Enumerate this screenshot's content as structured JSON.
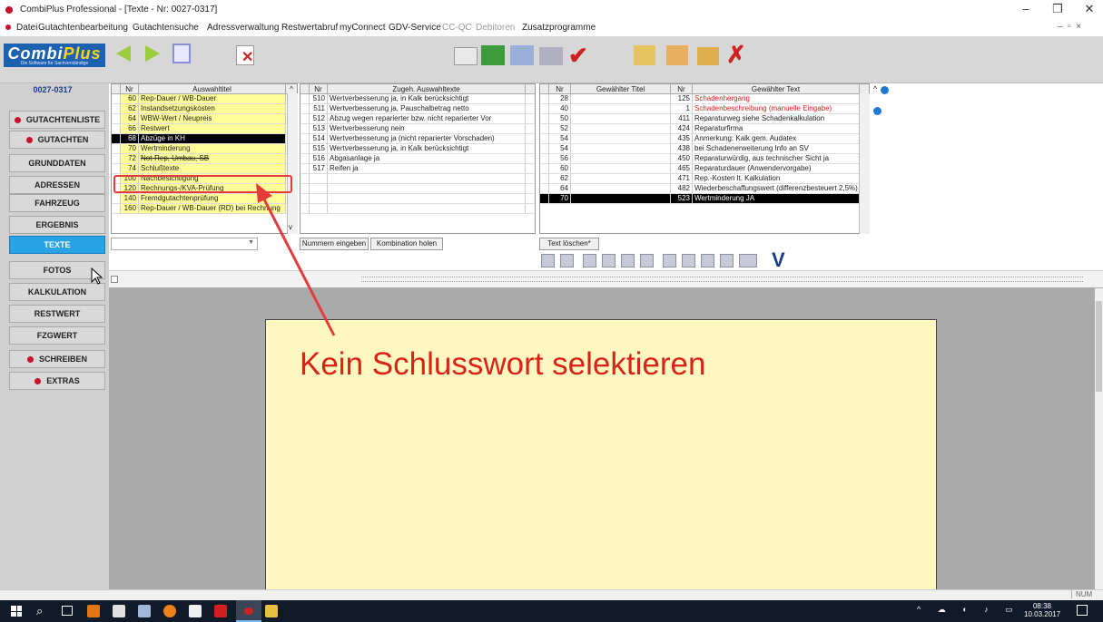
{
  "window": {
    "title": "CombiPlus Professional - [Texte - Nr: 0027-0317]"
  },
  "menu": [
    "Datei",
    "Gutachtenbearbeitung",
    "Gutachtensuche",
    "Adressverwaltung",
    "Restwertabruf",
    "myConnect",
    "GDV-Service",
    "CC-QC",
    "Debitoren",
    "Zusatzprogramme"
  ],
  "logo": {
    "brand": "Combi",
    "brand2": "Plus",
    "tagline": "Die Software für Sachverständige"
  },
  "case_number": "0027-0317",
  "nav": [
    {
      "label": "GUTACHTENLISTE",
      "dot": true
    },
    {
      "label": "GUTACHTEN",
      "dot": true
    },
    {
      "label": "GRUNDDATEN",
      "dot": false
    },
    {
      "label": "ADRESSEN",
      "dot": false
    },
    {
      "label": "FAHRZEUG",
      "dot": false
    },
    {
      "label": "ERGEBNIS",
      "dot": false
    },
    {
      "label": "TEXTE",
      "dot": false
    },
    {
      "label": "FOTOS",
      "dot": false
    },
    {
      "label": "KALKULATION",
      "dot": false
    },
    {
      "label": "RESTWERT",
      "dot": false
    },
    {
      "label": "FZGWERT",
      "dot": false
    },
    {
      "label": "SCHREIBEN",
      "dot": true
    },
    {
      "label": "EXTRAS",
      "dot": true
    }
  ],
  "grid1": {
    "headers": [
      "Nr",
      "Auswahltitel"
    ],
    "rows": [
      [
        "60",
        "Rep-Dauer / WB-Dauer"
      ],
      [
        "62",
        "Instandsetzungskosten"
      ],
      [
        "64",
        "WBW-Wert / Neupreis"
      ],
      [
        "66",
        "Restwert"
      ],
      [
        "68",
        "Abzüge in KH"
      ],
      [
        "70",
        "Wertminderung"
      ],
      [
        "72",
        "Not-Rep, Umbau, SB"
      ],
      [
        "74",
        "Schlußtexte"
      ],
      [
        "100",
        "Nachbesichtigung"
      ],
      [
        "120",
        "Rechnungs-/KVA-Prüfung"
      ],
      [
        "140",
        "Fremdgutachtenprüfung"
      ],
      [
        "160",
        "Rep-Dauer / WB-Dauer (RD) bei Rechnung"
      ]
    ]
  },
  "grid2": {
    "headers": [
      "Nr",
      "Zugeh. Auswahltexte"
    ],
    "rows": [
      [
        "510",
        "Wertverbesserung ja, in Kalk berücksichtigt"
      ],
      [
        "511",
        "Wertverbesserung ja, Pauschalbetrag netto"
      ],
      [
        "512",
        "Abzug wegen reparierter bzw. nicht reparierter Vor"
      ],
      [
        "513",
        "Wertverbesserung nein"
      ],
      [
        "514",
        "Wertverbesserung ja (nicht reparierter Vorschaden)"
      ],
      [
        "515",
        "Wertverbesserung ja, in Kalk berücksichtigt"
      ],
      [
        "516",
        "Abgasanlage ja"
      ],
      [
        "517",
        "Reifen ja"
      ],
      [
        "",
        ""
      ],
      [
        "",
        ""
      ],
      [
        "",
        ""
      ],
      [
        "",
        ""
      ]
    ]
  },
  "grid3": {
    "headers": [
      "Nr",
      "Gewählter Titel",
      "Nr",
      "Gewählter Text"
    ],
    "rows": [
      [
        "28",
        "",
        "125",
        "Schadenhergang"
      ],
      [
        "40",
        "",
        "1",
        "Schadenbeschreibung (manuelle Eingabe)"
      ],
      [
        "50",
        "",
        "411",
        "Reparaturweg siehe Schadenkalkulation"
      ],
      [
        "52",
        "",
        "424",
        "Reparaturfirma"
      ],
      [
        "54",
        "",
        "435",
        "Anmerkung: Kalk gem. Audatex"
      ],
      [
        "54",
        "",
        "438",
        "bei Schadenerweiterung Info an SV"
      ],
      [
        "56",
        "",
        "450",
        "Reparaturwürdig, aus technischer Sicht ja"
      ],
      [
        "60",
        "",
        "465",
        "Reparaturdauer (Anwendervorgabe)"
      ],
      [
        "62",
        "",
        "471",
        "Rep.-Kosten lt. Kalkulation"
      ],
      [
        "64",
        "",
        "482",
        "Wiederbeschaffungswert (differenzbesteuert 2,5%)"
      ],
      [
        "70",
        "",
        "523",
        "Wertminderung JA"
      ]
    ]
  },
  "buttons": {
    "nummern": "Nummern eingeben",
    "kombination": "Kombination holen",
    "text_loeschen": "Text löschen*"
  },
  "annotation": "Kein Schlusswort selektieren",
  "status": {
    "num": "NUM"
  },
  "taskbar": {
    "time": "08:38",
    "date": "10.03.2017"
  }
}
